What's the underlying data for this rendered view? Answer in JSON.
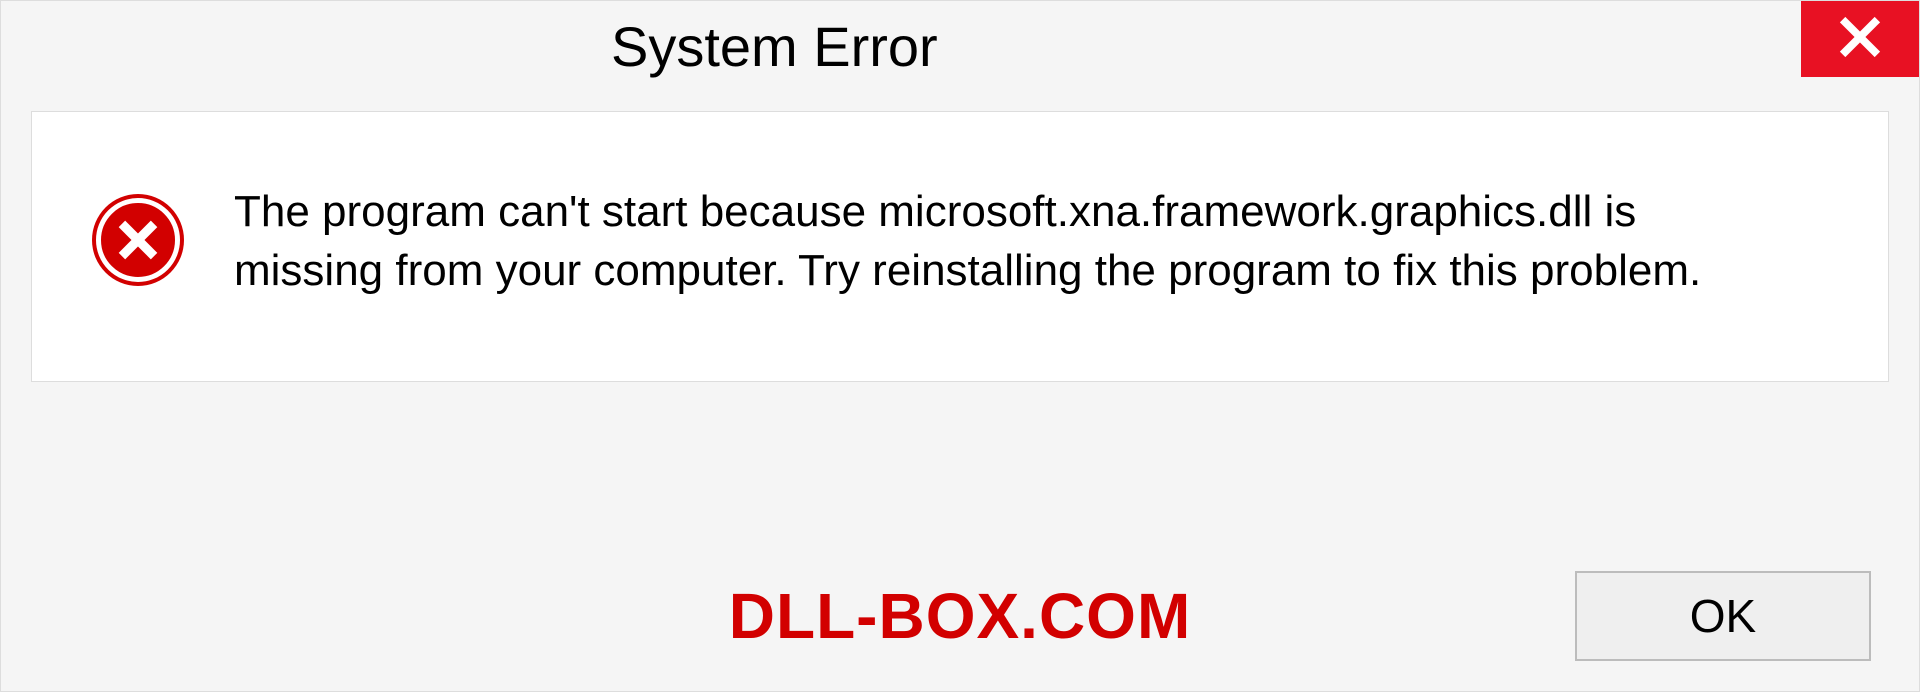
{
  "dialog": {
    "title": "System Error",
    "message": "The program can't start because microsoft.xna.framework.graphics.dll is missing from your computer. Try reinstalling the program to fix this problem.",
    "ok_label": "OK"
  },
  "watermark": "DLL-BOX.COM"
}
